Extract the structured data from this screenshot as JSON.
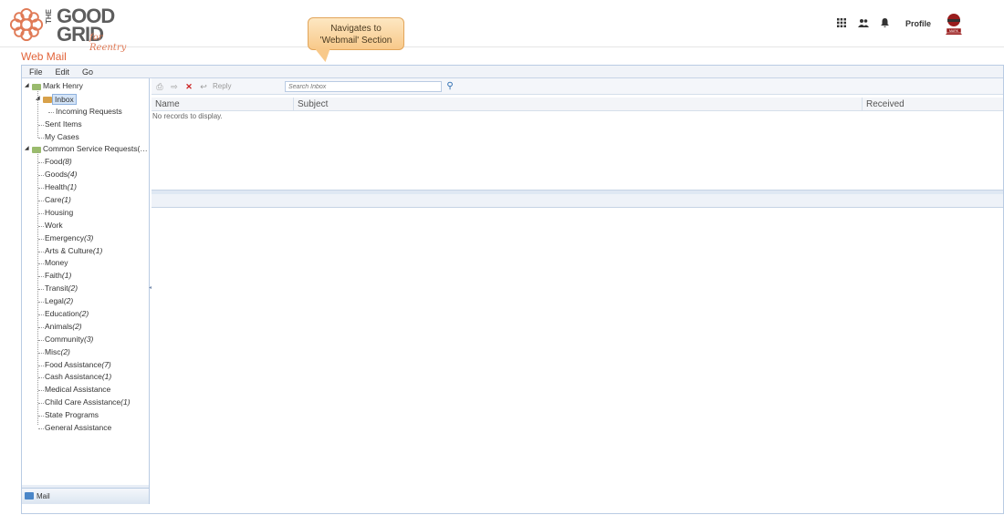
{
  "brand": {
    "the": "THE",
    "line1": "GOOD",
    "line2": "GRID",
    "tagline": "for Reentry"
  },
  "callout": {
    "line1": "Navigates to",
    "line2": "'Webmail' Section"
  },
  "header": {
    "icons": [
      "apps-icon",
      "users-icon",
      "bell-icon"
    ],
    "profile_label": "Profile",
    "avatar_text": "MARK"
  },
  "page_title": "Web Mail",
  "menu": [
    "File",
    "Edit",
    "Go"
  ],
  "tree": {
    "root": "Mark Henry",
    "inbox": "Inbox",
    "inbox_children": [
      "Incoming Requests"
    ],
    "root_items": [
      "Sent Items",
      "My Cases"
    ],
    "common": "Common Service Requests(…",
    "categories": [
      {
        "label": "Food",
        "count": "(8)"
      },
      {
        "label": "Goods",
        "count": "(4)"
      },
      {
        "label": "Health",
        "count": "(1)"
      },
      {
        "label": "Care",
        "count": "(1)"
      },
      {
        "label": "Housing",
        "count": ""
      },
      {
        "label": "Work",
        "count": ""
      },
      {
        "label": "Emergency",
        "count": "(3)"
      },
      {
        "label": "Arts & Culture",
        "count": "(1)"
      },
      {
        "label": "Money",
        "count": ""
      },
      {
        "label": "Faith",
        "count": "(1)"
      },
      {
        "label": "Transit",
        "count": "(2)"
      },
      {
        "label": "Legal",
        "count": "(2)"
      },
      {
        "label": "Education",
        "count": "(2)"
      },
      {
        "label": "Animals",
        "count": "(2)"
      },
      {
        "label": "Community",
        "count": "(3)"
      },
      {
        "label": "Misc",
        "count": "(2)"
      },
      {
        "label": "Food Assistance",
        "count": "(7)"
      },
      {
        "label": "Cash Assistance",
        "count": "(1)"
      },
      {
        "label": "Medical Assistance",
        "count": ""
      },
      {
        "label": "Child Care Assistance",
        "count": "(1)"
      },
      {
        "label": "State Programs",
        "count": ""
      },
      {
        "label": "General Assistance",
        "count": ""
      }
    ]
  },
  "mail_tab": "Mail",
  "toolbar": {
    "reply_label": "Reply",
    "search_placeholder": "Search Inbox"
  },
  "grid": {
    "columns": [
      "Name",
      "Subject",
      "Received"
    ],
    "empty_text": "No records to display."
  },
  "colors": {
    "accent": "#e2643a",
    "border": "#b9cbe3",
    "selected": "#d4e4f7"
  }
}
